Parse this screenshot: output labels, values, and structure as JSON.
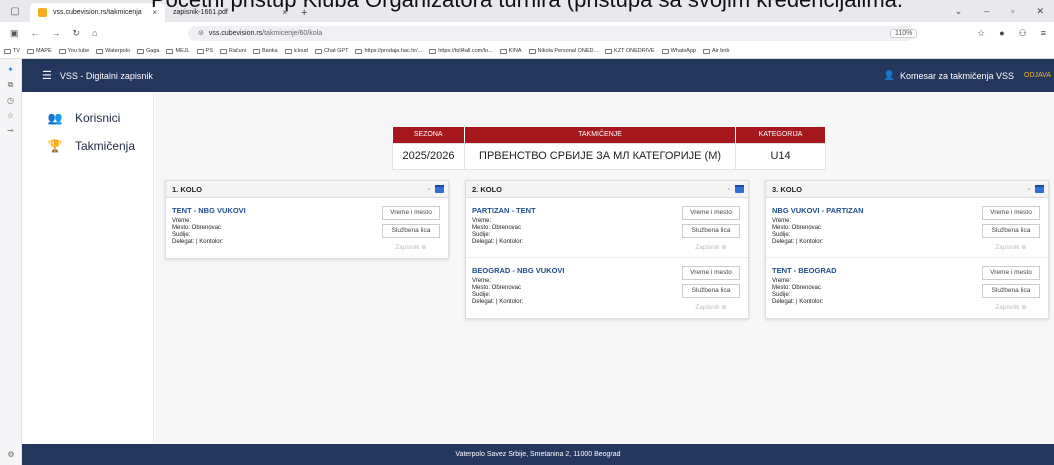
{
  "caption": "Početni pristup Kluba Organizatora turnira (pristupa sa svojim kredencijalima.",
  "browser": {
    "tabs": [
      {
        "label": "vss.cubevision.rs/takmicenja",
        "close": "×"
      },
      {
        "label": "zapisnik-1661.pdf",
        "close": "×"
      }
    ],
    "new_tab": "+",
    "url_domain": "vss.cubevision.rs",
    "url_path": "/takmicenje/60/kola",
    "zoom": "110%",
    "bookmarks": [
      "TV",
      "MAPE",
      "You tube",
      "Waterpolo",
      "Gaga",
      "MEJL",
      "PS",
      "Računi",
      "Banka",
      "icloud",
      "Chat GPT",
      "https://prodaja.hac.hr/...",
      "https://toll4all.com/lo...",
      "KINA",
      "Nikola Personal ONED...",
      "KZT ONEDRIVE",
      "WhatsApp",
      "Air bnb"
    ]
  },
  "app": {
    "title": "VSS - Digitalni zapisnik",
    "user": "Komesar za takmičenja VSS",
    "logout": "ODJAVA",
    "footer": "Vaterpolo Savez Srbije, Smetanina 2, 11000 Beograd"
  },
  "sidebar": {
    "items": [
      {
        "label": "Korisnici",
        "icon": "users-icon"
      },
      {
        "label": "Takmičenja",
        "icon": "trophy-icon"
      }
    ]
  },
  "season_table": {
    "headers": [
      "SEZONA",
      "TAKMIČENJE",
      "KATEGORIJA"
    ],
    "values": [
      "2025/2026",
      "ПРВЕНСТВО СРБИЈЕ ЗА МЛ КАТЕГОРИЈЕ (М)",
      "U14"
    ]
  },
  "labels": {
    "vreme": "Vreme:",
    "mesto": "Mesto: Obrenovac",
    "sudije": "Sudije:",
    "delegat": "Delegat: | Kontolor:",
    "btn_vreme": "Vreme i mesto",
    "btn_lica": "Službena lica",
    "btn_zapisnik": "Zapisnik ⊕",
    "dash": "-"
  },
  "rounds": [
    {
      "title": "1. KOLO",
      "matches": [
        "TENT - NBG VUKOVI"
      ]
    },
    {
      "title": "2. KOLO",
      "matches": [
        "PARTIZAN - TENT",
        "BEOGRAD - NBG VUKOVI"
      ]
    },
    {
      "title": "3. KOLO",
      "matches": [
        "NBG VUKOVI - PARTIZAN",
        "TENT - BEOGRAD"
      ]
    }
  ]
}
